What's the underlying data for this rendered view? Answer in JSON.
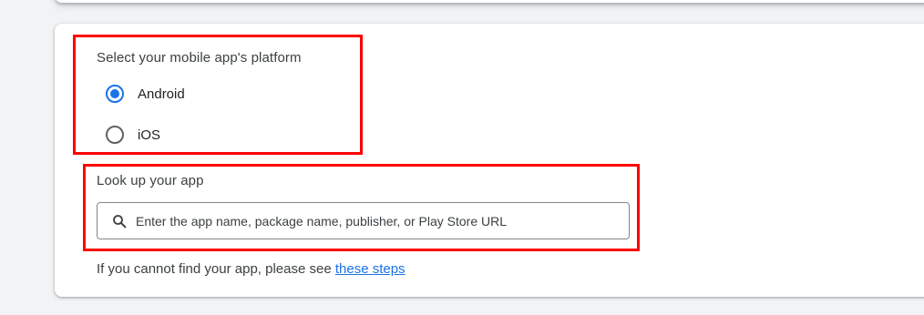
{
  "platform": {
    "label": "Select your mobile app's platform",
    "options": [
      {
        "label": "Android",
        "selected": true
      },
      {
        "label": "iOS",
        "selected": false
      }
    ]
  },
  "lookup": {
    "label": "Look up your app",
    "placeholder": "Enter the app name, package name, publisher, or Play Store URL",
    "value": ""
  },
  "help": {
    "text": "If you cannot find your app, please see ",
    "link_text": "these steps"
  },
  "colors": {
    "accent": "#1a73e8",
    "highlight": "#ff0000"
  }
}
